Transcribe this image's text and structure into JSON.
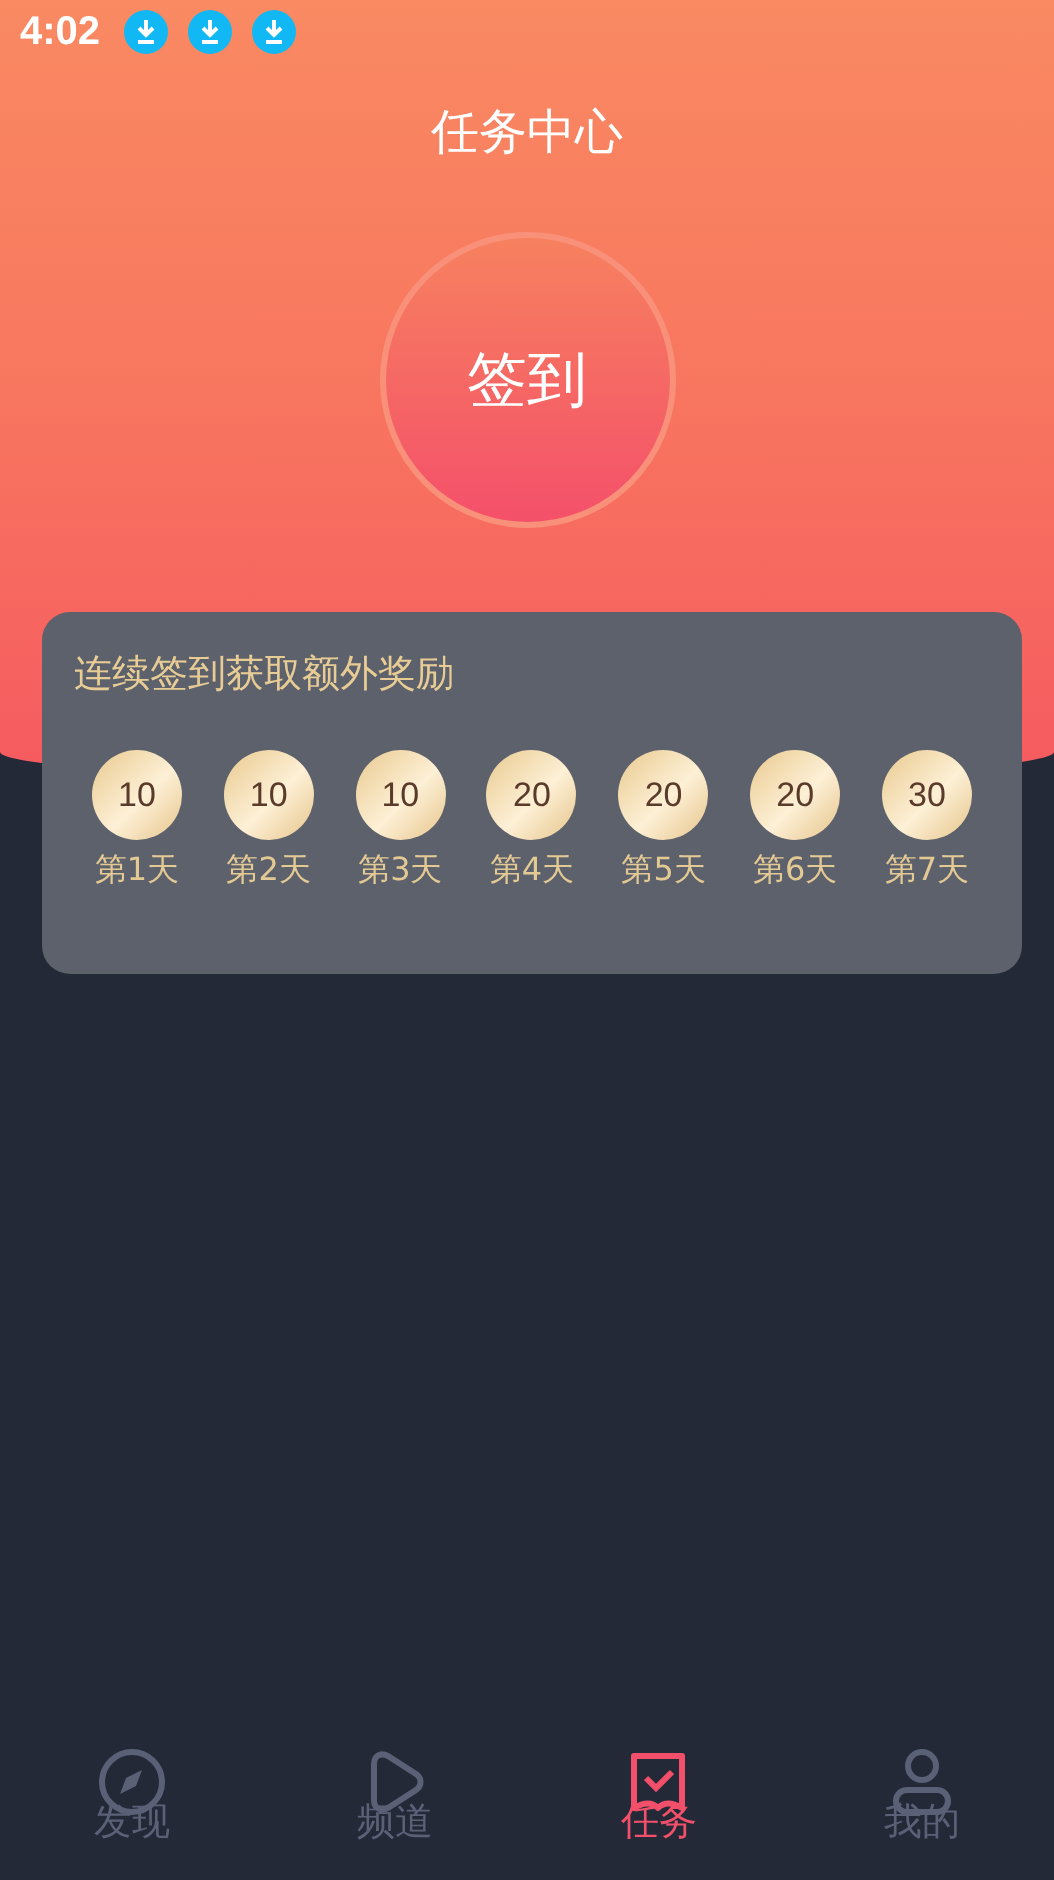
{
  "status_bar": {
    "time": "4:02",
    "notifications": [
      {
        "kind": "download"
      },
      {
        "kind": "download"
      },
      {
        "kind": "download"
      }
    ]
  },
  "title": "任务中心",
  "checkin_button": {
    "label": "签到"
  },
  "rewards": {
    "heading": "连续签到获取额外奖励",
    "days": [
      {
        "points": "10",
        "label": "第1天"
      },
      {
        "points": "10",
        "label": "第2天"
      },
      {
        "points": "10",
        "label": "第3天"
      },
      {
        "points": "20",
        "label": "第4天"
      },
      {
        "points": "20",
        "label": "第5天"
      },
      {
        "points": "20",
        "label": "第6天"
      },
      {
        "points": "30",
        "label": "第7天"
      }
    ]
  },
  "tabs": [
    {
      "label": "发现",
      "kind": "compass",
      "selected": false
    },
    {
      "label": "频道",
      "kind": "play",
      "selected": false
    },
    {
      "label": "任务",
      "kind": "task",
      "selected": true
    },
    {
      "label": "我的",
      "kind": "person",
      "selected": false
    }
  ]
}
